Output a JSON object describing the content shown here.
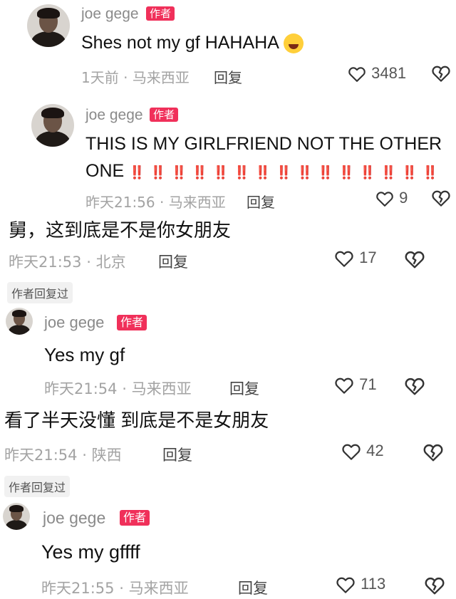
{
  "comments": [
    {
      "author": "joe gege",
      "badge": "作者",
      "text": "Shes not my gf HAHAHA",
      "emoji": "laughing-crying-emoji",
      "time": "1天前",
      "location": "马来西亚",
      "reply": "回复",
      "likes": "3481"
    },
    {
      "author": "joe gege",
      "badge": "作者",
      "text_line1": "THIS IS MY GIRLFRIEND NOT THE OTHER",
      "text_line2": "ONE",
      "bangs": "‼️ ‼️ ‼️ ‼️ ‼️ ‼️ ‼️ ‼️ ‼️ ‼️ ‼️ ‼️ ‼️ ‼️ ‼️",
      "time": "昨天21:56",
      "location": "马来西亚",
      "reply": "回复",
      "likes": "9"
    },
    {
      "text": "舅，这到底是不是你女朋友",
      "time": "昨天21:53",
      "location": "北京",
      "reply": "回复",
      "likes": "17",
      "author_replied": "作者回复过"
    },
    {
      "author": "joe gege",
      "badge": "作者",
      "text": "Yes my gf",
      "time": "昨天21:54",
      "location": "马来西亚",
      "reply": "回复",
      "likes": "71"
    },
    {
      "text": "看了半天没懂 到底是不是女朋友",
      "time": "昨天21:54",
      "location": "陕西",
      "reply": "回复",
      "likes": "42",
      "author_replied": "作者回复过"
    },
    {
      "author": "joe gege",
      "badge": "作者",
      "text": "Yes my gffff",
      "time": "昨天21:55",
      "location": "马来西亚",
      "reply": "回复",
      "likes": "113"
    }
  ],
  "separator": "·",
  "colors": {
    "badge": "#f0305a",
    "bangs": "#e0263a",
    "meta": "#a3a3a3"
  }
}
